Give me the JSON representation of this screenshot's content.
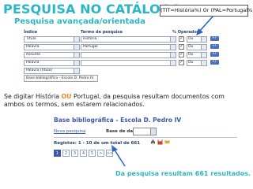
{
  "title": "PESQUISA NO CATÁLOGO",
  "subtitle": "Pesquisa avançada/orientada",
  "query": "(TIT=História%) Or (PAL=Portugal%)",
  "form": {
    "col_indice": "Índice",
    "col_termo": "Termo de pesquisa",
    "col_operador": "% Operador",
    "rows": [
      {
        "indice": "Título",
        "termo": "História",
        "checked": true,
        "operador": "Ou",
        "btn": "+/-"
      },
      {
        "indice": "Palavra",
        "termo": "Portugal",
        "checked": true,
        "operador": "Ou",
        "btn": "+/-"
      },
      {
        "indice": "Assunto",
        "termo": "",
        "checked": true,
        "operador": "Ou",
        "btn": "+/-"
      },
      {
        "indice": "Palavra",
        "termo": "",
        "checked": true,
        "operador": "Ou",
        "btn": "+/-"
      },
      {
        "indice": "Palavra (titulo)",
        "termo": "",
        "checked": false,
        "operador": "",
        "btn": ""
      }
    ],
    "base": "Base bibliográfica - Escola D. Pedro IV"
  },
  "paragraph": {
    "before": "Se digitar História ",
    "ou": "OU",
    "after": " Portugal, da pesquisa resultam documentos com ambos os termos, sem estarem relacionados."
  },
  "results": {
    "base_title": "Base bibliográfica - Escola D. Pedro IV",
    "new_search": "Nova pesquisa",
    "base_label": "Base de dados",
    "registos": "Registos: 1 - 10 de um total de 661",
    "pages": [
      "1",
      "2",
      "3",
      "4",
      "5",
      ">",
      ">>"
    ],
    "active_page": "1"
  },
  "bottom_note": "Da pesquisa resultam 661 resultados.",
  "colors": {
    "title": "#2bb6c8",
    "accent_blue": "#3a5aa8",
    "ou_highlight": "#e08a1e",
    "arrow": "#2e67c9"
  }
}
